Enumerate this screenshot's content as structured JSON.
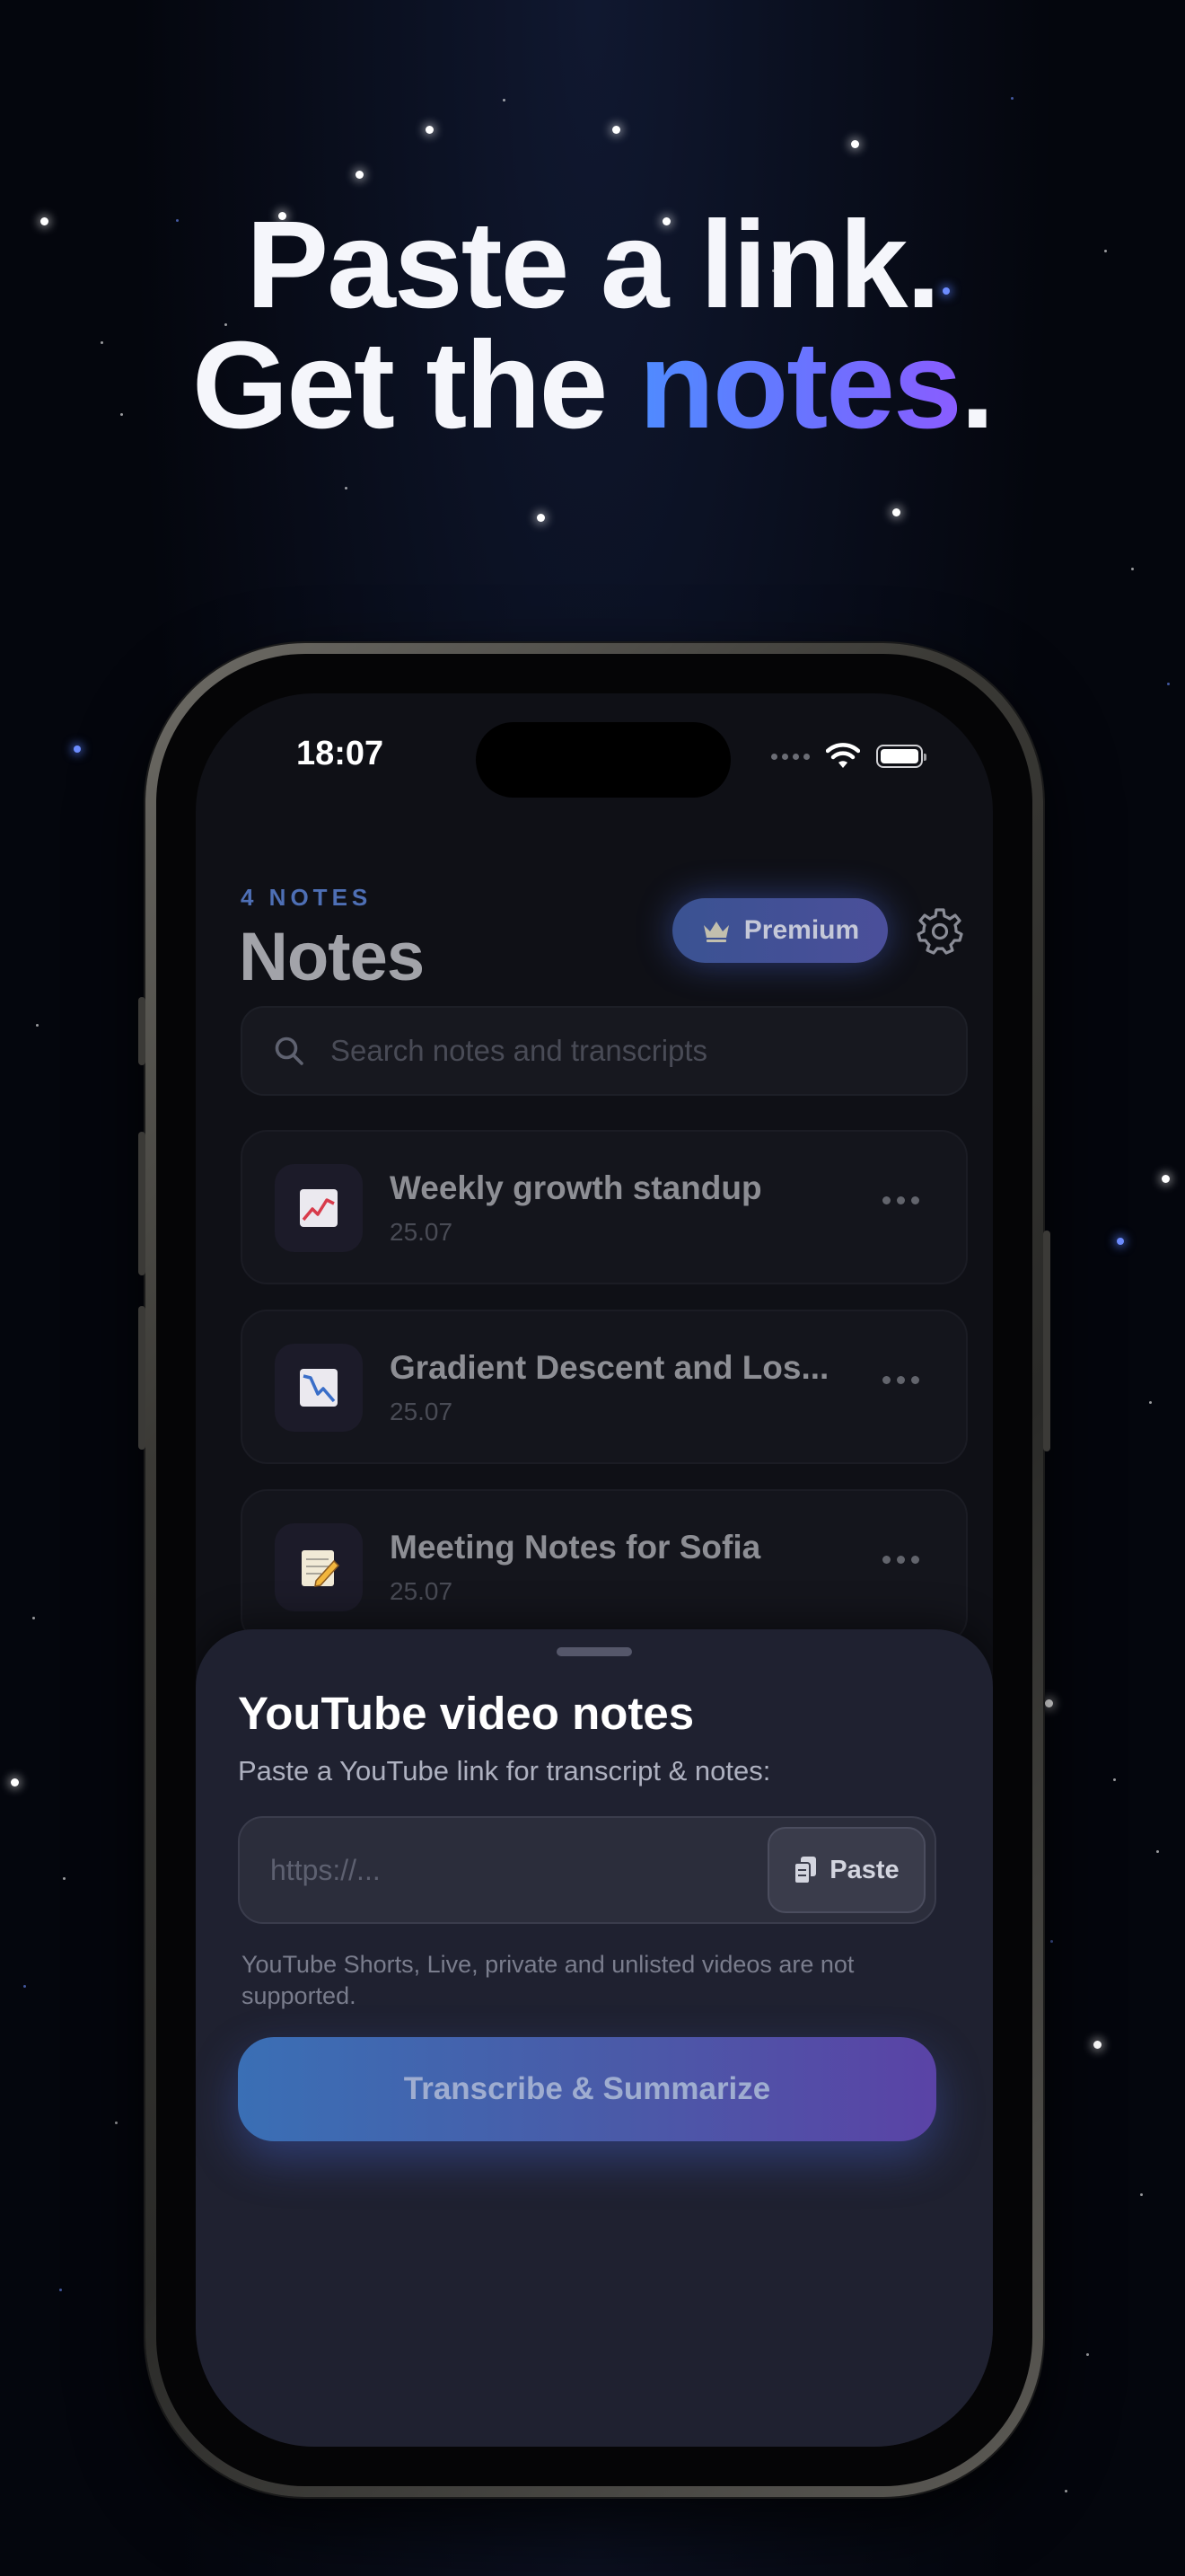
{
  "headline": {
    "line1": "Paste a link.",
    "line2_prefix": "Get the ",
    "line2_accent": "notes",
    "line2_suffix": "."
  },
  "status_bar": {
    "time": "18:07"
  },
  "header": {
    "count_label": "4 NOTES",
    "title": "Notes",
    "premium_label": "Premium"
  },
  "search": {
    "placeholder": "Search notes and transcripts"
  },
  "notes": [
    {
      "icon": "chart-up-icon",
      "emoji": "📈",
      "title": "Weekly growth standup",
      "date": "25.07"
    },
    {
      "icon": "chart-down-icon",
      "emoji": "📉",
      "title": "Gradient Descent and Los...",
      "date": "25.07"
    },
    {
      "icon": "memo-icon",
      "emoji": "📝",
      "title": "Meeting Notes for Sofia",
      "date": "25.07"
    }
  ],
  "sheet": {
    "title": "YouTube video notes",
    "subtitle": "Paste a YouTube link for transcript & notes:",
    "url_placeholder": "https://...",
    "paste_label": "Paste",
    "note": "YouTube Shorts, Live, private and unlisted videos are not supported.",
    "cta_label": "Transcribe & Summarize"
  },
  "colors": {
    "accent_blue": "#4f8bff",
    "accent_purple": "#8a5cff",
    "background": "#04060d"
  }
}
